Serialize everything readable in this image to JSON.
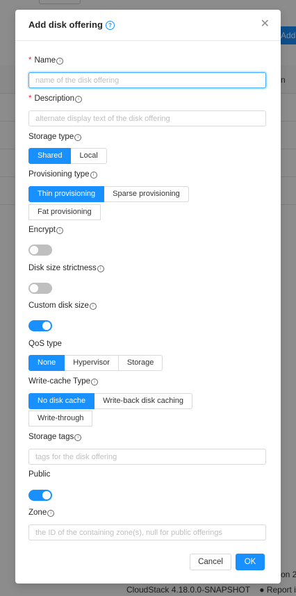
{
  "background": {
    "add_button_label": "Add d",
    "column_label": "n",
    "right_text": "on 2",
    "footer_version": "CloudStack 4.18.0.0-SNAPSHOT",
    "footer_report": "Report i"
  },
  "modal": {
    "title": "Add disk offering",
    "name": {
      "label": "Name",
      "placeholder": "name of the disk offering",
      "value": ""
    },
    "description": {
      "label": "Description",
      "placeholder": "alternate display text of the disk offering",
      "value": ""
    },
    "storage_type": {
      "label": "Storage type",
      "options": [
        "Shared",
        "Local"
      ],
      "selected": "Shared"
    },
    "provisioning_type": {
      "label": "Provisioning type",
      "options": [
        "Thin provisioning",
        "Sparse provisioning",
        "Fat provisioning"
      ],
      "selected": "Thin provisioning"
    },
    "encrypt": {
      "label": "Encrypt",
      "on": false
    },
    "disk_size_strictness": {
      "label": "Disk size strictness",
      "on": false
    },
    "custom_disk_size": {
      "label": "Custom disk size",
      "on": true
    },
    "qos_type": {
      "label": "QoS type",
      "options": [
        "None",
        "Hypervisor",
        "Storage"
      ],
      "selected": "None"
    },
    "write_cache_type": {
      "label": "Write-cache Type",
      "options": [
        "No disk cache",
        "Write-back disk caching",
        "Write-through"
      ],
      "selected": "No disk cache"
    },
    "storage_tags": {
      "label": "Storage tags",
      "placeholder": "tags for the disk offering",
      "value": ""
    },
    "public": {
      "label": "Public",
      "on": true
    },
    "zone": {
      "label": "Zone",
      "placeholder": "the ID of the containing zone(s), null for public offerings",
      "value": ""
    },
    "cancel_label": "Cancel",
    "ok_label": "OK"
  },
  "icons": {
    "help": "question-circle-icon",
    "info": "info-circle-icon",
    "close": "close-icon",
    "github": "github-icon"
  },
  "colors": {
    "primary": "#1890ff",
    "required": "#f5222d",
    "switch_off": "#bfbfbf"
  }
}
